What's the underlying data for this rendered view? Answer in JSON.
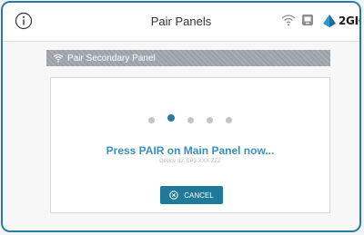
{
  "header": {
    "title": "Pair Panels",
    "brand_text": "2GIG",
    "icons": [
      "info-icon",
      "wifi-icon",
      "panel-icon",
      "brand-logo-icon"
    ]
  },
  "section": {
    "title": "Pair Secondary Panel",
    "icon": "wifi-icon"
  },
  "pairing": {
    "progress_dots": 5,
    "active_dot": 1,
    "message": "Press PAIR on Main Panel now...",
    "device_id": "Device ID: SP3-XXX-ZZZ"
  },
  "actions": {
    "cancel_label": "CANCEL",
    "cancel_icon": "close-circle-icon"
  },
  "colors": {
    "accent": "#2a7ba3",
    "message": "#3a8fbf",
    "button": "#1f7a9a",
    "section_header": "#9aa0a6"
  }
}
